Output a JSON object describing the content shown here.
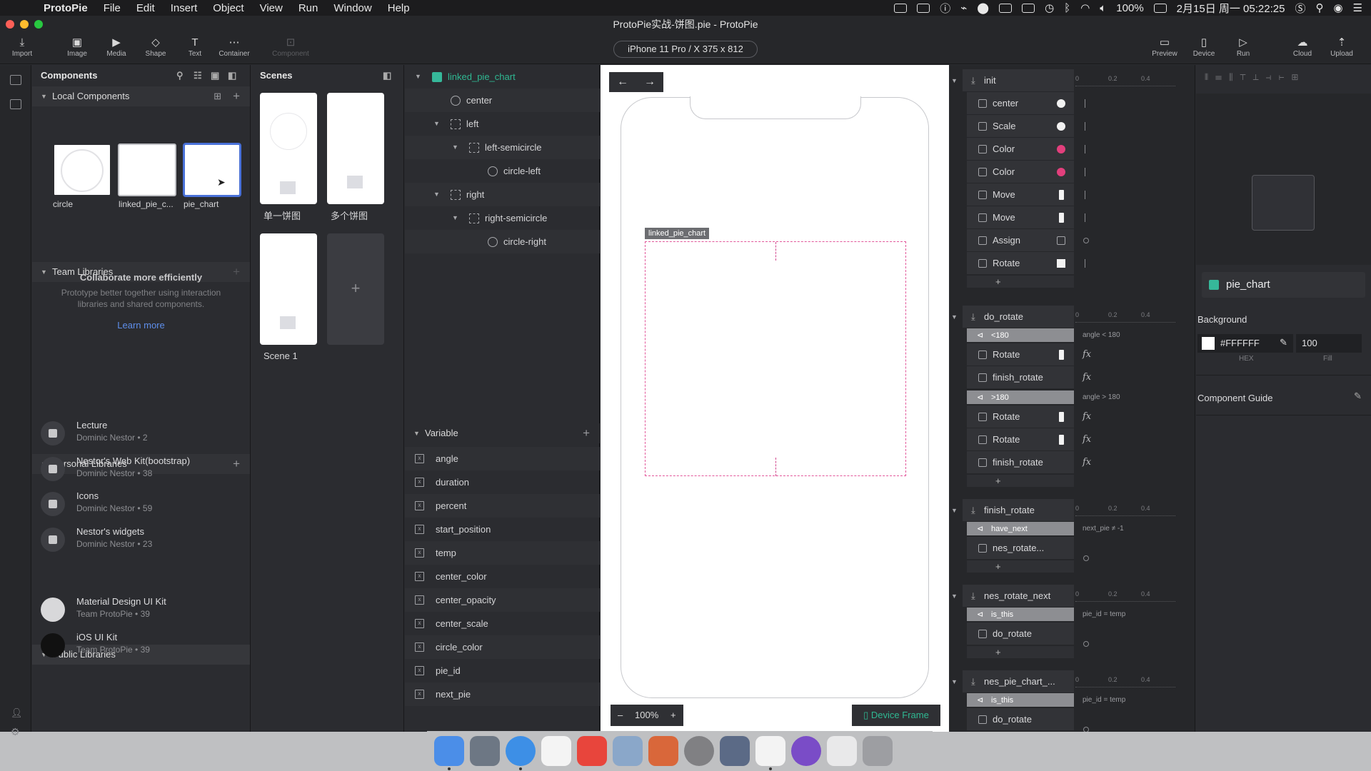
{
  "menubar": {
    "app": "ProtoPie",
    "items": [
      "File",
      "Edit",
      "Insert",
      "Object",
      "View",
      "Run",
      "Window",
      "Help"
    ],
    "battery": "100%",
    "datetime": "2月15日 周一  05:22:25"
  },
  "window": {
    "title": "ProtoPie实战-饼图.pie - ProtoPie",
    "device": "iPhone 11 Pro / X  375 x 812"
  },
  "toolbar": {
    "left": [
      {
        "label": "Import",
        "icon": "download-icon"
      },
      {
        "label": "Image",
        "icon": "image-icon"
      },
      {
        "label": "Media",
        "icon": "media-icon"
      },
      {
        "label": "Shape",
        "icon": "shape-icon"
      },
      {
        "label": "Text",
        "icon": "text-icon"
      },
      {
        "label": "Container",
        "icon": "container-icon"
      },
      {
        "label": "Component",
        "icon": "component-icon"
      }
    ],
    "right": [
      {
        "label": "Preview",
        "icon": "preview-icon"
      },
      {
        "label": "Device",
        "icon": "device-icon"
      },
      {
        "label": "Run",
        "icon": "run-icon"
      },
      {
        "label": "Cloud",
        "icon": "cloud-icon"
      },
      {
        "label": "Upload",
        "icon": "upload-icon"
      }
    ]
  },
  "components": {
    "title": "Components",
    "local_title": "Local Components",
    "local": [
      "circle",
      "linked_pie_c...",
      "pie_chart"
    ],
    "team_title": "Team Libraries",
    "team_empty_title": "Collaborate more efficiently",
    "team_empty_body": "Prototype better together using interaction libraries and shared components.",
    "learn_more": "Learn more",
    "personal_title": "Personal Libraries",
    "personal": [
      {
        "name": "Lecture",
        "sub": "Dominic Nestor • 2"
      },
      {
        "name": "Nestor's Web Kit(bootstrap)",
        "sub": "Dominic Nestor • 38"
      },
      {
        "name": "Icons",
        "sub": "Dominic Nestor • 59"
      },
      {
        "name": "Nestor's widgets",
        "sub": "Dominic Nestor • 23"
      }
    ],
    "public_title": "Public Libraries",
    "public": [
      {
        "name": "Material Design UI Kit",
        "sub": "Team ProtoPie • 39"
      },
      {
        "name": "iOS UI Kit",
        "sub": "Team ProtoPie • 39"
      }
    ]
  },
  "scenes": {
    "title": "Scenes",
    "items": [
      "单一饼图",
      "多个饼图",
      "Scene 1"
    ],
    "add": "+"
  },
  "layers": {
    "items": [
      {
        "name": "linked_pie_chart",
        "indent": 0,
        "type": "comp",
        "expanded": true
      },
      {
        "name": "center",
        "indent": 1,
        "type": "circle"
      },
      {
        "name": "left",
        "indent": 1,
        "type": "grp",
        "expanded": true
      },
      {
        "name": "left-semicircle",
        "indent": 2,
        "type": "grp",
        "expanded": true
      },
      {
        "name": "circle-left",
        "indent": 3,
        "type": "circle"
      },
      {
        "name": "right",
        "indent": 1,
        "type": "grp",
        "expanded": true
      },
      {
        "name": "right-semicircle",
        "indent": 2,
        "type": "grp",
        "expanded": true
      },
      {
        "name": "circle-right",
        "indent": 3,
        "type": "circle"
      }
    ],
    "variable_title": "Variable",
    "variables": [
      "angle",
      "duration",
      "percent",
      "start_position",
      "temp",
      "center_color",
      "center_opacity",
      "center_scale",
      "circle_color",
      "pie_id",
      "next_pie"
    ]
  },
  "canvas": {
    "frame_label": "linked_pie_chart",
    "zoom": "100%",
    "minus": "–",
    "plus": "+",
    "device_frame": "Device Frame",
    "back": "←",
    "fwd": "→"
  },
  "interactions": {
    "timeline_ticks": [
      "0",
      "0.2",
      "0.4"
    ],
    "fx": "fx",
    "add": "+",
    "init": {
      "trigger": "init",
      "responses": [
        {
          "label": "center",
          "mark": "dot",
          "color": "#f2f2f2"
        },
        {
          "label": "Scale",
          "mark": "dot",
          "color": "#f2f2f2"
        },
        {
          "label": "Color",
          "mark": "dot",
          "color": "#e23f7c"
        },
        {
          "label": "Color",
          "mark": "dot",
          "color": "#e23f7c"
        },
        {
          "label": "Move",
          "mark": "bar"
        },
        {
          "label": "Move",
          "mark": "bar"
        },
        {
          "label": "Assign",
          "mark": "assign"
        },
        {
          "label": "Rotate",
          "mark": "sq"
        }
      ]
    },
    "do_rotate": {
      "trigger": "do_rotate",
      "cond1": "<180",
      "cond1_note": "angle < 180",
      "group1": [
        "Rotate",
        "finish_rotate"
      ],
      "cond2": ">180",
      "cond2_note": "angle > 180",
      "group2": [
        "Rotate",
        "Rotate",
        "finish_rotate"
      ]
    },
    "finish_rotate": {
      "trigger": "finish_rotate",
      "cond": "have_next",
      "cond_note": "next_pie ≠ -1",
      "response": "nes_rotate..."
    },
    "nes_rotate_next": {
      "trigger": "nes_rotate_next",
      "cond": "is_this",
      "cond_note": "pie_id = temp",
      "response": "do_rotate"
    },
    "nes_pie_chart": {
      "trigger": "nes_pie_chart_...",
      "cond": "is_this",
      "cond_note": "pie_id = temp",
      "response": "do_rotate"
    }
  },
  "props": {
    "name": "pie_chart",
    "background_label": "Background",
    "hex": "#FFFFFF",
    "hex_label": "HEX",
    "fill": "100",
    "fill_label": "Fill",
    "guide": "Component Guide",
    "bg_color": "#FFFFFF"
  }
}
